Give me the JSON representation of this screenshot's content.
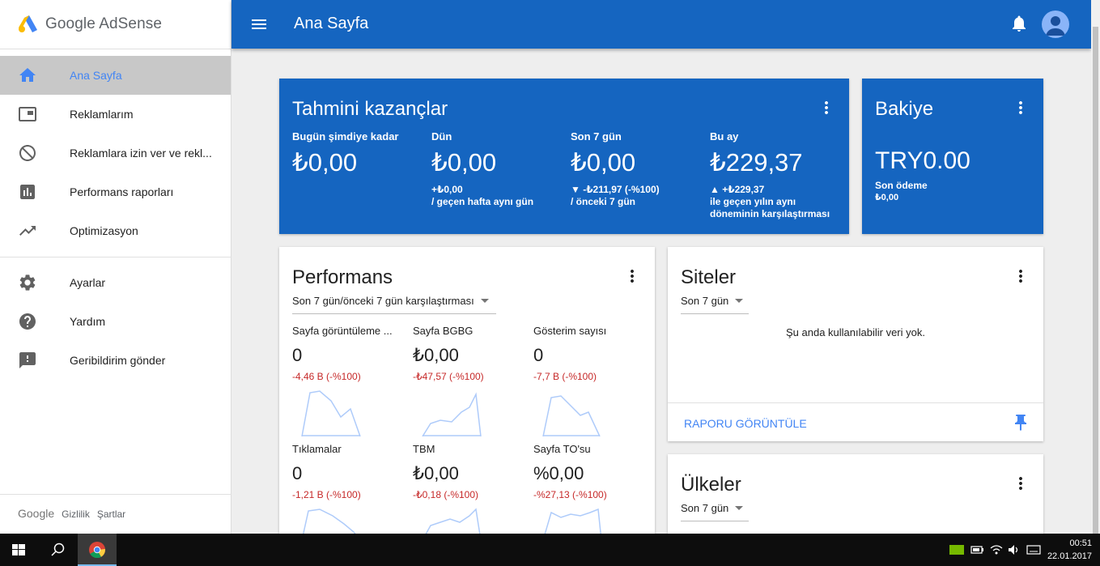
{
  "sidebar": {
    "logo": "Google AdSense",
    "items": [
      {
        "label": "Ana Sayfa"
      },
      {
        "label": "Reklamlarım"
      },
      {
        "label": "Reklamlara izin ver ve rekl..."
      },
      {
        "label": "Performans raporları"
      },
      {
        "label": "Optimizasyon"
      },
      {
        "label": "Ayarlar"
      },
      {
        "label": "Yardım"
      },
      {
        "label": "Geribildirim gönder"
      }
    ],
    "footer": {
      "google": "Google",
      "privacy": "Gizlilik",
      "terms": "Şartlar"
    }
  },
  "topbar": {
    "title": "Ana Sayfa"
  },
  "earnings": {
    "title": "Tahmini kazançlar",
    "today": {
      "label": "Bugün şimdiye kadar",
      "value": "₺0,00"
    },
    "yesterday": {
      "label": "Dün",
      "value": "₺0,00",
      "delta": "+₺0,00",
      "note": "/ geçen hafta aynı gün"
    },
    "last7": {
      "label": "Son 7 gün",
      "value": "₺0,00",
      "delta": "▼ -₺211,97 (-%100)",
      "note": "/ önceki 7 gün"
    },
    "month": {
      "label": "Bu ay",
      "value": "₺229,37",
      "delta": "▲ +₺229,37",
      "note1": "ile geçen yılın aynı",
      "note2": "döneminin karşılaştırması"
    }
  },
  "balance": {
    "title": "Bakiye",
    "value": "TRY0.00",
    "last_label": "Son ödeme",
    "last_value": "₺0,00"
  },
  "performance": {
    "title": "Performans",
    "dropdown": "Son 7 gün/önceki 7 gün karşılaştırması",
    "metrics": [
      {
        "label": "Sayfa görüntüleme ...",
        "value": "0",
        "delta": "-4,46 B (-%100)"
      },
      {
        "label": "Sayfa BGBG",
        "value": "₺0,00",
        "delta": "-₺47,57 (-%100)"
      },
      {
        "label": "Gösterim sayısı",
        "value": "0",
        "delta": "-7,7 B (-%100)"
      },
      {
        "label": "Tıklamalar",
        "value": "0",
        "delta": "-1,21 B (-%100)"
      },
      {
        "label": "TBM",
        "value": "₺0,00",
        "delta": "-₺0,18 (-%100)"
      },
      {
        "label": "Sayfa TO'su",
        "value": "%0,00",
        "delta": "-%27,13 (-%100)"
      }
    ]
  },
  "sites": {
    "title": "Siteler",
    "dropdown": "Son 7 gün",
    "empty": "Şu anda kullanılabilir veri yok.",
    "action": "RAPORU GÖRÜNTÜLE"
  },
  "countries": {
    "title": "Ülkeler",
    "dropdown": "Son 7 gün"
  },
  "taskbar": {
    "time": "00:51",
    "date": "22.01.2017"
  },
  "colors": {
    "primary": "#1565c0",
    "accent": "#4285f4",
    "negative": "#c62828"
  }
}
